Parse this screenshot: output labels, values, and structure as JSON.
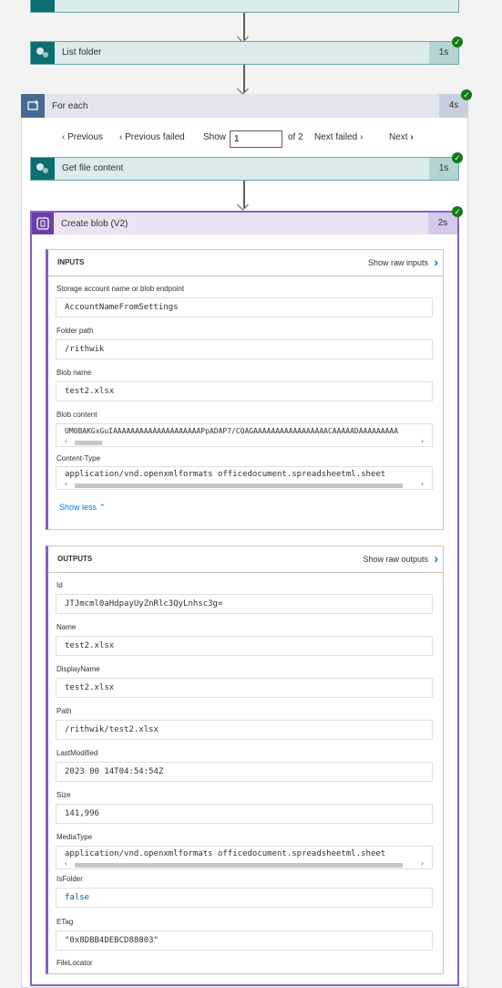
{
  "steps": {
    "list_folder": {
      "title": "List folder",
      "duration": "1s"
    },
    "for_each": {
      "title": "For each",
      "duration": "4s"
    },
    "get_file": {
      "title": "Get file content",
      "duration": "1s"
    },
    "create_blob": {
      "title": "Create blob (V2)",
      "duration": "2s"
    }
  },
  "pager": {
    "previous": "Previous",
    "previous_failed": "Previous failed",
    "show": "Show",
    "current": "1",
    "of": "of 2",
    "next_failed": "Next failed",
    "next": "Next"
  },
  "inputs": {
    "header": "INPUTS",
    "raw_link": "Show raw inputs",
    "fields": [
      {
        "label": "Storage account name or blob endpoint",
        "value": "AccountNameFromSettings"
      },
      {
        "label": "Folder path",
        "value": "/rithwik"
      },
      {
        "label": "Blob name",
        "value": "test2.xlsx"
      },
      {
        "label": "Blob content",
        "value": "UM0BAKGxGuIAAAAAAAAAAAAAAAAAAAAPpADAP7/CQAGAAAAAAAAAAAAAAAAACAAAAADAAAAAAAAA"
      },
      {
        "label": "Content-Type",
        "value": "application/vnd.openxmlformats officedocument.spreadsheetml.sheet"
      }
    ],
    "show_less": "Show less"
  },
  "outputs": {
    "header": "OUTPUTS",
    "raw_link": "Show raw outputs",
    "fields": [
      {
        "label": "Id",
        "value": "JTJmcml0aHdpayUyZnRlc3QyLnhsc3g="
      },
      {
        "label": "Name",
        "value": "test2.xlsx"
      },
      {
        "label": "DisplayName",
        "value": "test2.xlsx"
      },
      {
        "label": "Path",
        "value": "/rithwik/test2.xlsx"
      },
      {
        "label": "LastModified",
        "value": "2023 00 14T04:54:54Z"
      },
      {
        "label": "Size",
        "value": "141,996"
      },
      {
        "label": "MediaType",
        "value": "application/vnd.openxmlformats officedocument.spreadsheetml.sheet"
      },
      {
        "label": "IsFolder",
        "value": "false"
      },
      {
        "label": "ETag",
        "value": "\"0x8DBB4DEBCD88803\""
      },
      {
        "label": "FileLocator",
        "value": ""
      }
    ]
  },
  "colors": {
    "teal_connector": "#0f6e70",
    "foreach": "#486991",
    "blob": "#8661c5",
    "success": "#107c10",
    "link": "#0078d4"
  },
  "icons": [
    "sharepoint-icon",
    "loop-icon",
    "blob-storage-icon",
    "check-icon",
    "chevron-right-icon",
    "chevron-left-icon",
    "chevron-up-icon"
  ]
}
